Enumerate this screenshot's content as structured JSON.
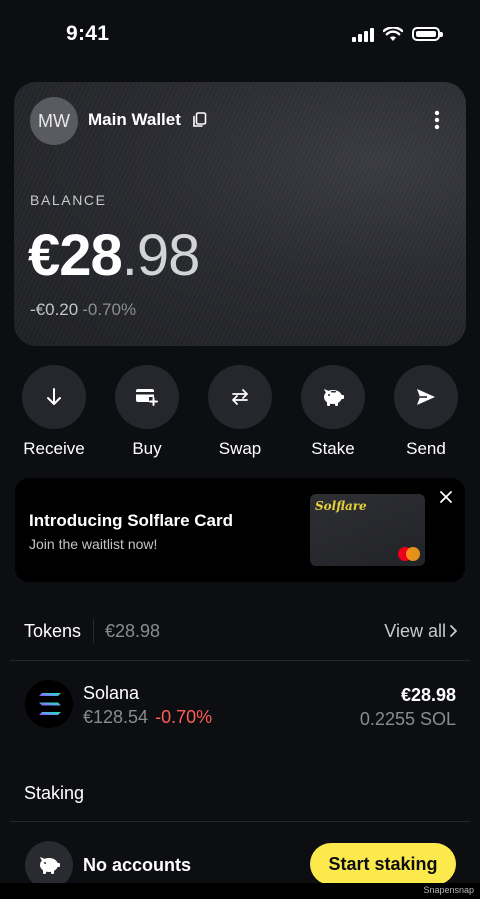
{
  "status_bar": {
    "time": "9:41"
  },
  "wallet": {
    "avatar_initials": "MW",
    "name": "Main Wallet",
    "balance_label": "BALANCE",
    "balance_integer": "€28",
    "balance_decimal": ".98",
    "change_amount": "-€0.20",
    "change_percent": "-0.70%"
  },
  "actions": [
    {
      "label": "Receive",
      "icon": "arrow-down-icon"
    },
    {
      "label": "Buy",
      "icon": "card-plus-icon"
    },
    {
      "label": "Swap",
      "icon": "swap-arrows-icon"
    },
    {
      "label": "Stake",
      "icon": "piggy-bank-icon"
    },
    {
      "label": "Send",
      "icon": "paper-plane-icon"
    }
  ],
  "promo": {
    "title": "Introducing Solflare Card",
    "subtitle": "Join the waitlist now!",
    "card_brand": "Solflare"
  },
  "tokens": {
    "label": "Tokens",
    "total": "€28.98",
    "view_all": "View all",
    "items": [
      {
        "name": "Solana",
        "price": "€128.54",
        "change": "-0.70%",
        "value": "€28.98",
        "amount": "0.2255 SOL"
      }
    ]
  },
  "staking": {
    "label": "Staking",
    "empty_text": "No accounts",
    "start_button": "Start staking"
  },
  "footer": {
    "watermark": "Snapensnap"
  },
  "colors": {
    "accent": "#fce94b",
    "negative": "#ff5b57",
    "background": "#0d0e12"
  }
}
